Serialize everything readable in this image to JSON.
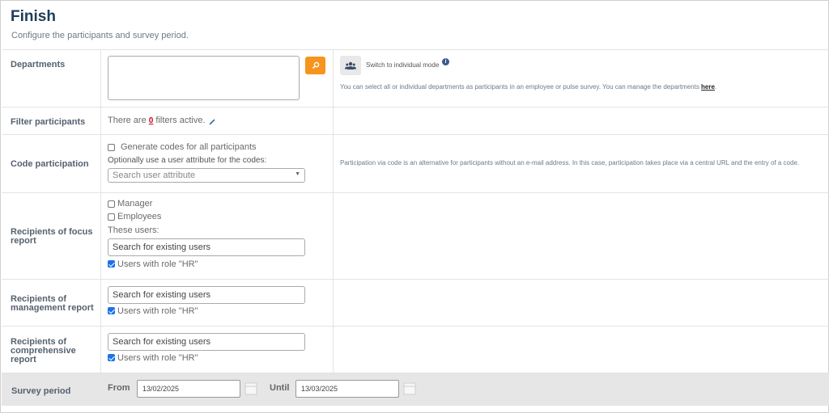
{
  "header": {
    "title": "Finish",
    "subtitle": "Configure the participants and survey period."
  },
  "departments": {
    "label": "Departments",
    "switch_label": "Switch to individual mode",
    "help_text": "You can select all or individual departments as participants in an employee or pulse survey. You can manage the departments ",
    "help_link": "here",
    "help_end": ".",
    "search_icon": "search-icon",
    "people_icon": "users-icon",
    "info_icon": "info-icon"
  },
  "filter": {
    "label": "Filter participants",
    "prefix": "There are",
    "count": "0",
    "suffix": "filters active.",
    "edit_icon": "pencil-icon"
  },
  "code": {
    "label": "Code participation",
    "generate_label": "Generate codes for all participants",
    "attribute_label": "Optionally use a user attribute for the codes:",
    "attribute_placeholder": "Search user attribute",
    "help_text": "Participation via code is an alternative for participants without an e-mail address. In this case, participation takes place via a central URL and the entry of a code."
  },
  "focus": {
    "label_line1": "Recipients of focus",
    "label_line2": "report",
    "manager_label": "Manager",
    "employees_label": "Employees",
    "these_users": "These users:",
    "search_placeholder": "Search for existing users",
    "hr_label": "Users with role \"HR\""
  },
  "management": {
    "label_line1": "Recipients of",
    "label_line2": "management report",
    "search_placeholder": "Search for existing users",
    "hr_label": "Users with role \"HR\""
  },
  "comprehensive": {
    "label_line1": "Recipients of",
    "label_line2": "comprehensive",
    "label_line3": "report",
    "search_placeholder": "Search for existing users",
    "hr_label": "Users with role \"HR\""
  },
  "period": {
    "label": "Survey period",
    "from_label": "From",
    "from_value": "13/02/2025",
    "until_label": "Until",
    "until_value": "13/03/2025",
    "calendar_icon": "calendar-icon"
  },
  "colors": {
    "accent": "#f7941d",
    "title": "#1d3b59",
    "checkbox": "#1a73e8",
    "count": "#d0021b"
  }
}
